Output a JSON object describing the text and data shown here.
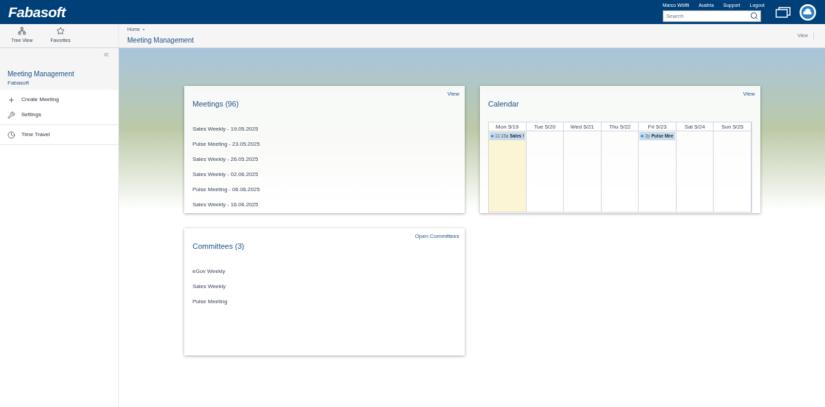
{
  "header": {
    "logo": "Fabasoft",
    "links": [
      "Marco Wölfli",
      "Austria",
      "Support",
      "Logout"
    ],
    "search": {
      "placeholder": "Search"
    }
  },
  "toolbar": [
    {
      "label": "Tree View",
      "kind": "tree"
    },
    {
      "label": "Favorites",
      "kind": "star"
    }
  ],
  "breadcrumb": {
    "items": [
      "Home"
    ],
    "title": "Meeting Management",
    "view": "View"
  },
  "sidebar": {
    "title": "Meeting Management",
    "subtitle": "Fabasoft",
    "groups": [
      [
        {
          "label": "Create Meeting",
          "kind": "plus"
        },
        {
          "label": "Settings",
          "kind": "tools"
        }
      ],
      [
        {
          "label": "Time Travel",
          "kind": "clock"
        }
      ]
    ]
  },
  "meetings": {
    "title": "Meetings (96)",
    "action": "View",
    "items": [
      "Sales Weekly - 19.05.2025",
      "Pulse Meeting - 23.05.2025",
      "Sales Weekly - 26.05.2025",
      "Sales Weekly - 02.06.2025",
      "Pulse Meeting - 06.06.2025",
      "Sales Weekly - 16.06.2025"
    ]
  },
  "calendar": {
    "title": "Calendar",
    "action": "View",
    "days": [
      {
        "label": "Mon 5/19",
        "selected": true,
        "events": [
          {
            "time": "11:15a",
            "title": "Sales !",
            "color": "#3b8fd9"
          }
        ]
      },
      {
        "label": "Tue 5/20",
        "selected": false
      },
      {
        "label": "Wed 5/21",
        "selected": false
      },
      {
        "label": "Thu 5/22",
        "selected": false
      },
      {
        "label": "Fri 5/23",
        "selected": false,
        "events": [
          {
            "time": "2p",
            "title": "Pulse Mee",
            "color": "#3b8fd9"
          }
        ]
      },
      {
        "label": "Sat 5/24",
        "selected": false
      },
      {
        "label": "Sun 5/25",
        "selected": false
      }
    ]
  },
  "committees": {
    "title": "Committees (3)",
    "action": "Open Committees",
    "items": [
      "eGov Weekly",
      "Sales Weekly",
      "Pulse Meeting"
    ]
  }
}
